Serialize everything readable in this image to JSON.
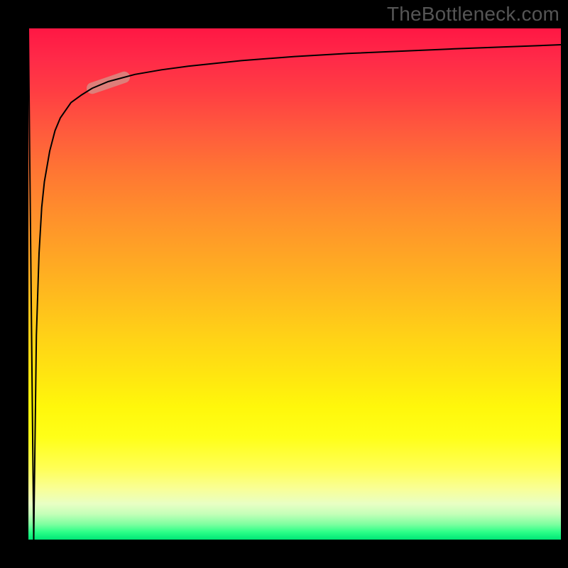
{
  "watermark": "TheBottleneck.com",
  "colors": {
    "top": "#ff1744",
    "mid": "#ffe610",
    "bottom": "#00e676",
    "curve": "#000000",
    "highlight": "#d88b82",
    "frame": "#000000"
  },
  "chart_data": {
    "type": "line",
    "title": "",
    "xlabel": "",
    "ylabel": "",
    "xlim": [
      0,
      100
    ],
    "ylim": [
      0,
      100
    ],
    "grid": false,
    "legend": false,
    "series": [
      {
        "name": "curve",
        "x": [
          0,
          0.5,
          1,
          1.5,
          2,
          2.5,
          3,
          4,
          5,
          6,
          8,
          10,
          12,
          15,
          20,
          25,
          30,
          40,
          50,
          60,
          80,
          100
        ],
        "y": [
          100,
          50,
          0,
          40,
          56,
          65,
          70,
          76,
          80,
          82.5,
          85.5,
          87,
          88.3,
          89.6,
          91,
          91.9,
          92.6,
          93.7,
          94.5,
          95.1,
          96.0,
          96.8
        ]
      }
    ],
    "highlight_region": {
      "x_start": 12,
      "x_end": 18
    }
  }
}
